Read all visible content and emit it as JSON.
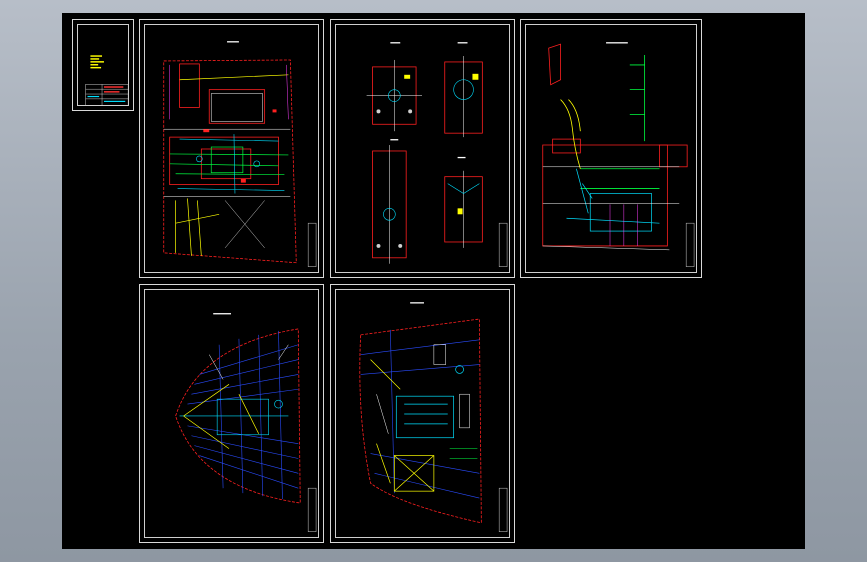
{
  "colors": {
    "background": "#000000",
    "frame": "#d9d9d9",
    "red": "#ff2020",
    "green": "#00ff40",
    "cyan": "#00e0ff",
    "blue": "#3060ff",
    "yellow": "#ffff00",
    "white": "#ffffff",
    "magenta": "#ff40ff"
  },
  "sheets": [
    {
      "id": "cover",
      "kind": "cover-sheet"
    },
    {
      "id": "plan-1",
      "kind": "general-arrangement-plan"
    },
    {
      "id": "details",
      "kind": "detail-views"
    },
    {
      "id": "section",
      "kind": "elevation-section"
    },
    {
      "id": "bow-plan",
      "kind": "hull-plan-bow"
    },
    {
      "id": "deck-plan",
      "kind": "hull-plan-deck"
    }
  ]
}
